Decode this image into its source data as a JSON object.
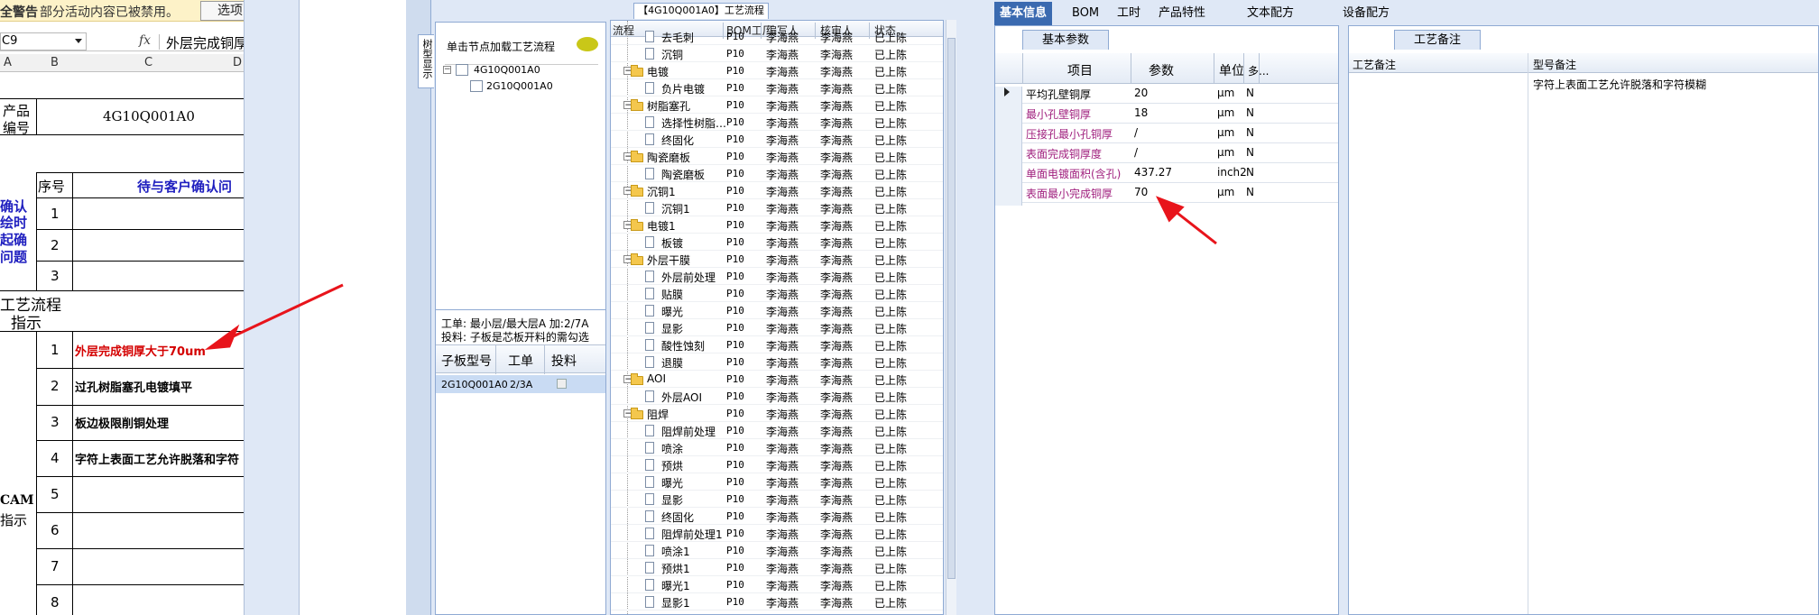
{
  "excel": {
    "warning_title": "全警告",
    "warning_message": "部分活动内容已被禁用。",
    "options_button": "选项",
    "name_box": "C9",
    "fx": "fx",
    "formula_text": "外层完成铜厚",
    "columns": [
      "A",
      "B",
      "C",
      "D"
    ],
    "product_label_1": "产品",
    "product_label_2": "编号",
    "product_number": "4G10Q001A0",
    "seq_header": "序号",
    "pending_header": "待与客户确认问",
    "confirm_lines": [
      "确认",
      "绘时",
      "起确",
      "问题"
    ],
    "confirm_rows": [
      "1",
      "2",
      "3"
    ],
    "process_label_1": "工艺流程",
    "process_label_2": "指示",
    "cam_label_1": "CAM",
    "cam_label_2": "指示",
    "instruction_numbers": [
      "1",
      "2",
      "3",
      "4",
      "5",
      "6",
      "7",
      "8"
    ],
    "instructions": [
      "外层完成铜厚大于70um",
      "过孔树脂塞孔电镀填平",
      "板边极限削铜处理",
      "字符上表面工艺允许脱落和字符",
      "",
      "",
      "",
      ""
    ]
  },
  "tree": {
    "side_tab": "树型显示",
    "hint": "单击节点加载工艺流程",
    "root": "4G10Q001A0",
    "child": "2G10Q001A0",
    "status_line_1": "工单: 最小层/最大层A 加:2/7A",
    "status_line_2": "投料: 子板是芯板开料的需勾选",
    "sub_headers": [
      "子板型号",
      "工单",
      "投料"
    ],
    "sub_row": {
      "model": "2G10Q001A0",
      "order": "2/3A"
    }
  },
  "flow": {
    "title": "【4G10Q001A0】工艺流程",
    "headers": [
      "流程",
      "BOM工厂",
      "编写人",
      "核审人",
      "状态"
    ],
    "factory": "P10",
    "writer": "李海燕",
    "reviewer": "李海燕",
    "status": "已上陈",
    "rows": [
      {
        "type": "doc",
        "name": "去毛刺"
      },
      {
        "type": "doc",
        "name": "沉铜"
      },
      {
        "type": "folder",
        "name": "电镀"
      },
      {
        "type": "doc",
        "name": "负片电镀"
      },
      {
        "type": "folder",
        "name": "树脂塞孔"
      },
      {
        "type": "doc",
        "name": "选择性树脂…"
      },
      {
        "type": "doc",
        "name": "终固化"
      },
      {
        "type": "folder",
        "name": "陶瓷磨板"
      },
      {
        "type": "doc",
        "name": "陶瓷磨板"
      },
      {
        "type": "folder",
        "name": "沉铜1"
      },
      {
        "type": "doc",
        "name": "沉铜1"
      },
      {
        "type": "folder",
        "name": "电镀1"
      },
      {
        "type": "doc",
        "name": "板镀"
      },
      {
        "type": "folder",
        "name": "外层干膜"
      },
      {
        "type": "doc",
        "name": "外层前处理"
      },
      {
        "type": "doc",
        "name": "贴膜"
      },
      {
        "type": "doc",
        "name": "曝光"
      },
      {
        "type": "doc",
        "name": "显影"
      },
      {
        "type": "doc",
        "name": "酸性蚀刻"
      },
      {
        "type": "doc",
        "name": "退膜"
      },
      {
        "type": "folder",
        "name": "AOI"
      },
      {
        "type": "doc",
        "name": "外层AOI"
      },
      {
        "type": "folder",
        "name": "阻焊"
      },
      {
        "type": "doc",
        "name": "阻焊前处理"
      },
      {
        "type": "doc",
        "name": "喷涂"
      },
      {
        "type": "doc",
        "name": "预烘"
      },
      {
        "type": "doc",
        "name": "曝光"
      },
      {
        "type": "doc",
        "name": "显影"
      },
      {
        "type": "doc",
        "name": "终固化"
      },
      {
        "type": "doc",
        "name": "阻焊前处理1"
      },
      {
        "type": "doc",
        "name": "喷涂1"
      },
      {
        "type": "doc",
        "name": "预烘1"
      },
      {
        "type": "doc",
        "name": "曝光1"
      },
      {
        "type": "doc",
        "name": "显影1"
      }
    ]
  },
  "tabs": [
    "基本信息",
    "BOM",
    "工时",
    "产品特性",
    "文本配方",
    "设备配方"
  ],
  "basic": {
    "subtab": "基本参数",
    "headers": [
      "项目",
      "参数",
      "单位",
      "多..."
    ],
    "rows": [
      {
        "item": "平均孔壁铜厚",
        "value": "20",
        "unit": "μm",
        "flag": "N",
        "color": "#000000"
      },
      {
        "item": "最小孔壁铜厚",
        "value": "18",
        "unit": "μm",
        "flag": "N",
        "color": "#a0207e"
      },
      {
        "item": "压接孔最小孔铜厚",
        "value": "/",
        "unit": "μm",
        "flag": "N",
        "color": "#a0207e"
      },
      {
        "item": "表面完成铜厚度",
        "value": "/",
        "unit": "μm",
        "flag": "N",
        "color": "#a0207e"
      },
      {
        "item": "单面电镀面积(含孔)",
        "value": "437.27",
        "unit": "inch2",
        "flag": "N",
        "color": "#a0207e"
      },
      {
        "item": "表面最小完成铜厚",
        "value": "70",
        "unit": "μm",
        "flag": "N",
        "color": "#a0207e"
      }
    ]
  },
  "remarks": {
    "subtab": "工艺备注",
    "headers": [
      "工艺备注",
      "型号备注"
    ],
    "model_remark": "字符上表面工艺允许脱落和字符模糊"
  },
  "colors": {
    "annotation": "#e8141b",
    "accent": "#3a6ab0",
    "panel_bg": "#dfe8f6",
    "instruction_red": "#d40000",
    "confirm_blue": "#1f1fbf"
  }
}
